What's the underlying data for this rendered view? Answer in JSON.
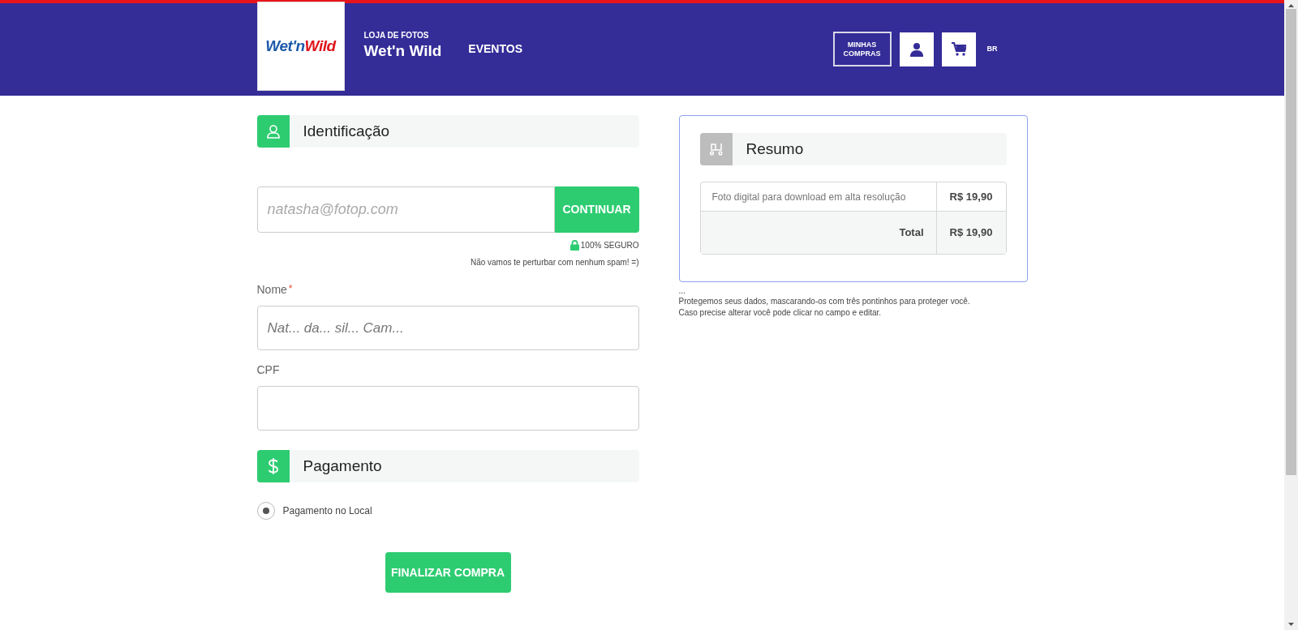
{
  "header": {
    "logo": [
      "Wet'n",
      "Wild"
    ],
    "store_caption": "LOJA DE FOTOS",
    "store_name": "Wet'n Wild",
    "nav": [
      {
        "label": "EVENTOS"
      }
    ],
    "my_purchases": "MINHAS COMPRAS",
    "language": "BR"
  },
  "identification": {
    "title": "Identificação",
    "email": {
      "placeholder": "natasha@fotop.com"
    },
    "continue": "CONTINUAR",
    "secure": "100% SEGURO",
    "spam_note": "Não vamos te perturbar com nenhum spam! =)",
    "fields": [
      {
        "label": "Nome",
        "required_mark": "*",
        "value": "Nat... da... sil... Cam..."
      },
      {
        "label": "CPF"
      }
    ]
  },
  "payment": {
    "title": "Pagamento",
    "options": [
      {
        "label": "Pagamento no Local",
        "selected": true
      }
    ],
    "finish": "FINALIZAR COMPRA"
  },
  "summary": {
    "title": "Resumo",
    "items": [
      {
        "description": "Foto digital para download em alta resolução",
        "price": "R$ 19,90"
      }
    ],
    "total_label": "Total",
    "total": "R$ 19,90"
  },
  "privacy_note": {
    "ellipsis": "...",
    "lines": [
      "Protegemos seus dados, mascarando-os com três pontinhos para proteger você.",
      "Caso precise alterar você pode clicar no campo e editar."
    ]
  }
}
